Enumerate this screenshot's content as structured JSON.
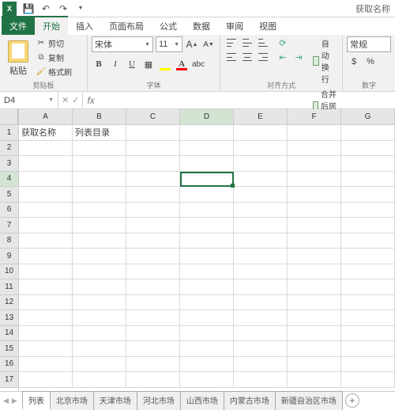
{
  "titlebar": {
    "title": "获取名称"
  },
  "tabs": {
    "file": "文件",
    "home": "开始",
    "insert": "插入",
    "pagelayout": "页面布局",
    "formulas": "公式",
    "data": "数据",
    "review": "审阅",
    "view": "视图"
  },
  "ribbon": {
    "clipboard": {
      "paste": "粘贴",
      "cut": "剪切",
      "copy": "复制",
      "painter": "格式刷",
      "label": "剪贴板"
    },
    "font": {
      "name": "宋体",
      "size": "11",
      "label": "字体"
    },
    "align": {
      "wrap": "自动换行",
      "merge": "合并后居中",
      "label": "对齐方式"
    },
    "number": {
      "format": "常规",
      "label": "数字"
    }
  },
  "namebox": "D4",
  "columns": [
    "A",
    "B",
    "C",
    "D",
    "E",
    "F",
    "G"
  ],
  "rows": [
    "1",
    "2",
    "3",
    "4",
    "5",
    "6",
    "7",
    "8",
    "9",
    "10",
    "11",
    "12",
    "13",
    "14",
    "15",
    "16",
    "17"
  ],
  "cells": {
    "A1": "获取名称",
    "B1": "列表目录"
  },
  "sheets": {
    "active": "列表",
    "others": [
      "北京市场",
      "天津市场",
      "河北市场",
      "山西市场",
      "内蒙古市场",
      "新疆自治区市场"
    ]
  },
  "active": {
    "col": "D",
    "row": "4"
  }
}
